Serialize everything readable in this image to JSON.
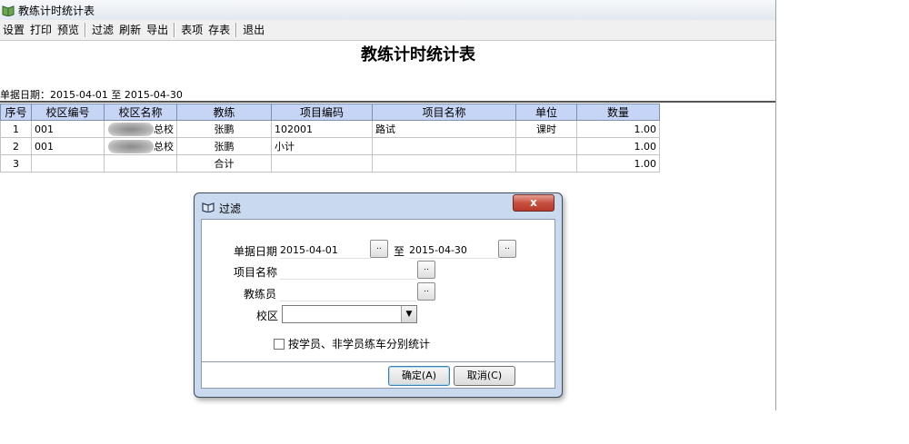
{
  "window": {
    "title": "教练计时统计表"
  },
  "toolbar": {
    "groups": [
      [
        "设置",
        "打印",
        "预览"
      ],
      [
        "过滤",
        "刷新",
        "导出"
      ],
      [
        "表项",
        "存表"
      ],
      [
        "退出"
      ]
    ]
  },
  "report": {
    "title": "教练计时统计表",
    "date_range": "单据日期：2015-04-01 至 2015-04-30"
  },
  "table": {
    "headers": [
      "序号",
      "校区编号",
      "校区名称",
      "教练",
      "项目编码",
      "项目名称",
      "单位",
      "数量"
    ],
    "rows": [
      {
        "no": "1",
        "campus_code": "001",
        "campus_name": "总校",
        "coach": "张鹏",
        "item_code": "102001",
        "item_name": "路试",
        "unit": "课时",
        "qty": "1.00"
      },
      {
        "no": "2",
        "campus_code": "001",
        "campus_name": "总校",
        "coach": "张鹏",
        "item_code": "小计",
        "item_name": "",
        "unit": "",
        "qty": "1.00"
      },
      {
        "no": "3",
        "campus_code": "",
        "campus_name": "",
        "coach": "合计",
        "item_code": "",
        "item_name": "",
        "unit": "",
        "qty": "1.00"
      }
    ]
  },
  "filter_dialog": {
    "title": "过滤",
    "close_label": "x",
    "date_label": "单据日期",
    "date_from": "2015-04-01",
    "to_label": "至",
    "date_to": "2015-04-30",
    "item_name_label": "项目名称",
    "item_name_value": "",
    "coach_label": "教练员",
    "coach_value": "",
    "campus_label": "校区",
    "campus_value": "",
    "browse_label": "..",
    "checkbox_label": "按学员、非学员练车分别统计",
    "checkbox_checked": false,
    "ok_label": "确定(A)",
    "cancel_label": "取消(C)"
  }
}
